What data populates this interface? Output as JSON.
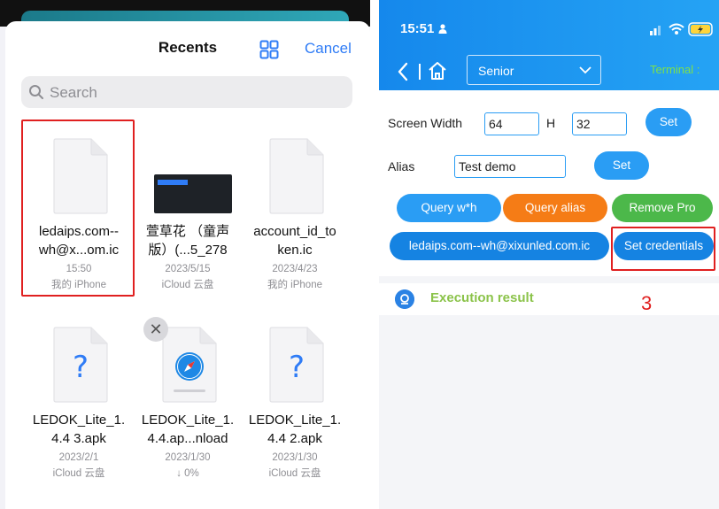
{
  "left_panel": {
    "title": "Recents",
    "cancel_label": "Cancel",
    "search_placeholder": "Search",
    "files": [
      {
        "name_line1": "ledaips.com--",
        "name_line2": "wh@x...om.ic",
        "meta1": "15:50",
        "meta2": "我的 iPhone",
        "icon": "blank-document-icon"
      },
      {
        "name_line1": "萱草花 （童声",
        "name_line2": "版）(...5_278",
        "meta1": "2023/5/15",
        "meta2": "iCloud 云盘",
        "icon": "video-thumbnail"
      },
      {
        "name_line1": "account_id_to",
        "name_line2": "ken.ic",
        "meta1": "2023/4/23",
        "meta2": "我的 iPhone",
        "icon": "blank-document-icon"
      },
      {
        "name_line1": "LEDOK_Lite_1.",
        "name_line2": "4.4 3.apk",
        "meta1": "2023/2/1",
        "meta2": "iCloud 云盘",
        "icon": "unknown-file-icon"
      },
      {
        "name_line1": "LEDOK_Lite_1.",
        "name_line2": "4.4.ap...nload",
        "meta1": "2023/1/30",
        "meta2": "↓ 0%",
        "icon": "safari-download-icon"
      },
      {
        "name_line1": "LEDOK_Lite_1.",
        "name_line2": "4.4 2.apk",
        "meta1": "2023/1/30",
        "meta2": "iCloud 云盘",
        "icon": "unknown-file-icon"
      }
    ],
    "remove_symbol": "✕"
  },
  "right_panel": {
    "time": "15:51",
    "mode_select": "Senior",
    "terminal_label": "Terminal :",
    "screen_width_label": "Screen Width",
    "screen_width_value": "64",
    "h_label": "H",
    "h_value": "32",
    "set_label": "Set",
    "alias_label": "Alias",
    "alias_value": "Test demo",
    "buttons": {
      "query_wh": "Query w*h",
      "query_alias": "Query alias",
      "remove_pro": "Remove Pro",
      "ledaips": "ledaips.com--wh@xixunled.com.ic",
      "set_credentials": "Set credentials"
    },
    "execution_result": "Execution result",
    "step_number": "3"
  },
  "colors": {
    "header_blue": "#1588ec",
    "ios_blue": "#2f7cf6",
    "highlight_red": "#e02020",
    "orange": "#f57c16",
    "green": "#4cb84a",
    "result_green": "#8bc34a"
  }
}
